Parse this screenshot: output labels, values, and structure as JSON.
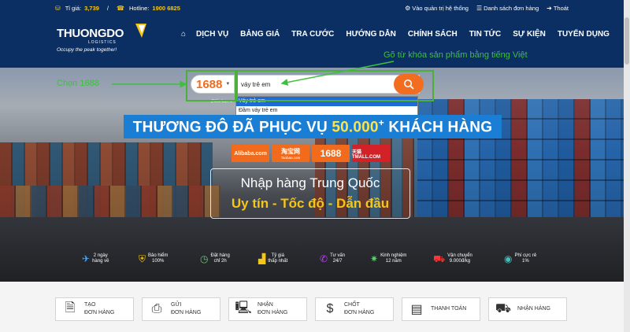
{
  "topbar": {
    "rate_label": "Tỉ giá:",
    "rate_value": "3,739",
    "hotline_label": "Hotline:",
    "hotline_value": "1900 6825",
    "links": [
      "Vào quản trị hệ thống",
      "Danh sách đơn hàng",
      "Thoát"
    ]
  },
  "logo": {
    "brand": "THUONGDO",
    "sub": "LOGISTICS",
    "slogan": "Occupy the peak together!"
  },
  "nav": {
    "items": [
      "DỊCH VỤ",
      "BẢNG GIÁ",
      "TRA CƯỚC",
      "HƯỚNG DẪN",
      "CHÍNH SÁCH",
      "TIN TỨC",
      "SỰ KIỆN",
      "TUYỂN DỤNG"
    ]
  },
  "search": {
    "platform": "1688",
    "query": "váy trẻ em",
    "note": "(Nếu bạn c",
    "suggestions": [
      "Váy trẻ em",
      "Đầm váy trẻ em"
    ]
  },
  "annotations": {
    "left": "Chọn 1688",
    "right": "Gõ từ khóa sản phẩm bằng tiếng Việt",
    "color": "#3fbf3f"
  },
  "banner": {
    "pre": "THƯƠNG ĐÔ ĐÃ PHỤC VỤ ",
    "num": "50.000",
    "plus": "+",
    "post": " KHÁCH HÀNG"
  },
  "platforms": [
    {
      "name": "Alibaba.com"
    },
    {
      "name": "淘宝网",
      "sub": "Taobao.com"
    },
    {
      "name": "1688"
    },
    {
      "name": "天猫 TMALL.COM"
    }
  ],
  "hero_box": {
    "line1": "Nhập hàng Trung Quốc",
    "line2": "Uy tín - Tốc độ - Dẫn đầu"
  },
  "features": [
    {
      "a": "2 ngày",
      "b": "hàng về"
    },
    {
      "a": "Bảo hiểm",
      "b": "100%"
    },
    {
      "a": "Đặt hàng",
      "b": "chỉ 2h"
    },
    {
      "a": "Tỷ giá",
      "b": "thấp nhất"
    },
    {
      "a": "Tư vấn",
      "b": "24/7"
    },
    {
      "a": "Kinh nghiệm",
      "b": "12 năm"
    },
    {
      "a": "Vận chuyển",
      "b": "9.000đ/kg"
    },
    {
      "a": "Phí cực rẻ",
      "b": "1%"
    }
  ],
  "steps": [
    {
      "a": "TẠO",
      "b": "ĐƠN HÀNG"
    },
    {
      "a": "GỬI",
      "b": "ĐƠN HÀNG"
    },
    {
      "a": "NHẬN",
      "b": "ĐƠN HÀNG"
    },
    {
      "a": "CHỐT",
      "b": "ĐƠN HÀNG"
    },
    {
      "a": "THANH TOÁN",
      "b": ""
    },
    {
      "a": "NHẬN HÀNG",
      "b": ""
    }
  ],
  "colors": {
    "navy": "#0c2f63",
    "orange": "#f26b1d",
    "banner_blue": "#1a7fd4",
    "gold": "#f5c518"
  }
}
